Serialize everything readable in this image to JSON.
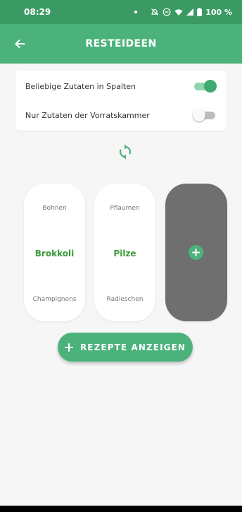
{
  "status_bar": {
    "time": "08:29",
    "battery": "100 %"
  },
  "app_bar": {
    "title": "RESTEIDEEN",
    "back_icon": "arrow-left-icon"
  },
  "settings": [
    {
      "label": "Beliebige Zutaten in Spalten",
      "enabled": true
    },
    {
      "label": "Nur Zutaten der Vorratskammer",
      "enabled": false
    }
  ],
  "shuffle_icon": "refresh-icon",
  "columns": [
    {
      "top": "Bohnen",
      "selected": "Brokkoli",
      "bottom": "Champignons"
    },
    {
      "top": "Pflaumen",
      "selected": "Pilze",
      "bottom": "Radieschen"
    }
  ],
  "add_column_icon": "plus-circle-icon",
  "show_recipes_label": "REZEPTE ANZEIGEN",
  "colors": {
    "status_bar": "#3b9a63",
    "app_bar": "#4cb27b",
    "accent": "#4cb27b",
    "selected_text": "#3a9a3a",
    "add_column": "#6f6f6f",
    "background": "#f6f6f6"
  }
}
